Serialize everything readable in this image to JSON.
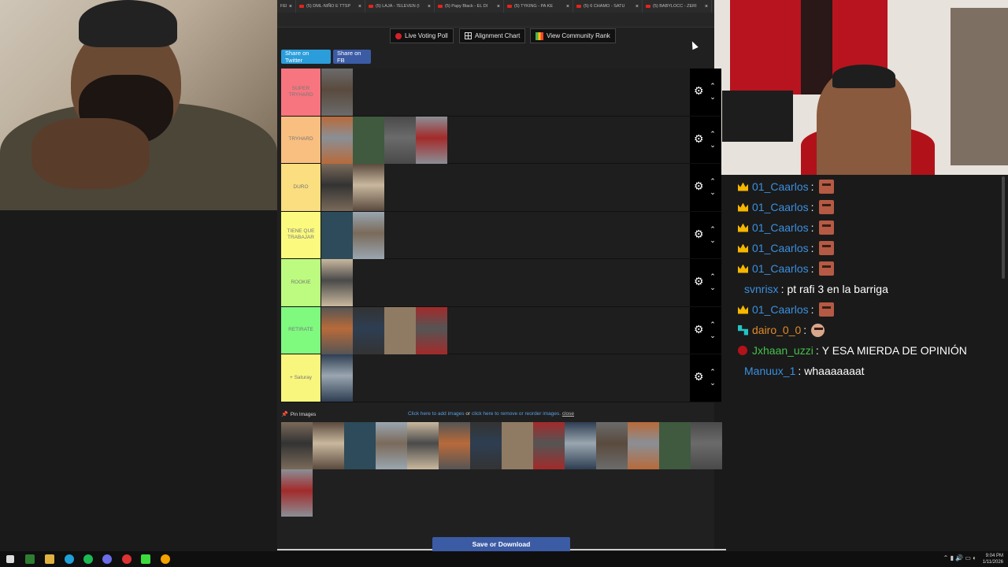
{
  "tabs": [
    {
      "label": "FEI"
    },
    {
      "label": "(5) DML-NIÑO E TTSP"
    },
    {
      "label": "(5) LAJA - 7ELEVEN (I"
    },
    {
      "label": "(5) Papy Black - EL DI"
    },
    {
      "label": "(5) TYKING - PA KE"
    },
    {
      "label": "(5) 6 CHAMO - SATU"
    },
    {
      "label": "(5) BABYLOCC - ZERI"
    }
  ],
  "toolbar": {
    "live_voting": "Live Voting Poll",
    "alignment_chart": "Alignment Chart",
    "community_rank": "View Community Rank",
    "share_twitter": "Share on Twitter",
    "share_fb": "Share on FB"
  },
  "tiers": [
    {
      "label": "SUPER TRYHARD",
      "color": "#f7757f",
      "count": 1
    },
    {
      "label": "TRYHARD",
      "color": "#f9bf80",
      "count": 4
    },
    {
      "label": "DURO",
      "color": "#fbde7f",
      "count": 2
    },
    {
      "label": "TIENE QUE TRABAJAR",
      "color": "#fbfa7f",
      "count": 2
    },
    {
      "label": "ROOKIE",
      "color": "#bcfb7f",
      "count": 1
    },
    {
      "label": "RETIRATE",
      "color": "#7ffa7f",
      "count": 4
    },
    {
      "label": "+ Saturay",
      "color": "#f9f67d",
      "count": 1
    }
  ],
  "pin": {
    "label": "Pin Images",
    "add_link": "Click here to add images",
    "or_text": "or",
    "remove_link": "click here to remove or reorder images.",
    "close_link": "close",
    "pool_count": 15
  },
  "save_label": "Save or Download",
  "chat": [
    {
      "badge": "crown",
      "user": "01_Caarlos",
      "color": "#3a8fe0",
      "text": "",
      "emote": "face"
    },
    {
      "badge": "crown",
      "user": "01_Caarlos",
      "color": "#3a8fe0",
      "text": "",
      "emote": "face"
    },
    {
      "badge": "crown",
      "user": "01_Caarlos",
      "color": "#3a8fe0",
      "text": "",
      "emote": "face"
    },
    {
      "badge": "crown",
      "user": "01_Caarlos",
      "color": "#3a8fe0",
      "text": "",
      "emote": "face"
    },
    {
      "badge": "crown",
      "user": "01_Caarlos",
      "color": "#3a8fe0",
      "text": "",
      "emote": "face"
    },
    {
      "badge": "",
      "user": "svnrisx",
      "color": "#3a8fe0",
      "text": "pt rafi 3 en la barriga",
      "emote": ""
    },
    {
      "badge": "crown",
      "user": "01_Caarlos",
      "color": "#3a8fe0",
      "text": "",
      "emote": "face"
    },
    {
      "badge": "bits",
      "user": "dairo_0_0",
      "color": "#e08a2a",
      "text": "",
      "emote": "small"
    },
    {
      "badge": "dot",
      "user": "Jxhaan_uzzi",
      "color": "#44c24a",
      "text": "Y ESA MIERDA DE OPINIÓN",
      "emote": ""
    },
    {
      "badge": "",
      "user": "Manuux_1",
      "color": "#3a8fe0",
      "text": "whaaaaaaat",
      "emote": ""
    }
  ],
  "clock": {
    "time": "9:04 PM",
    "date": "1/11/2026"
  }
}
